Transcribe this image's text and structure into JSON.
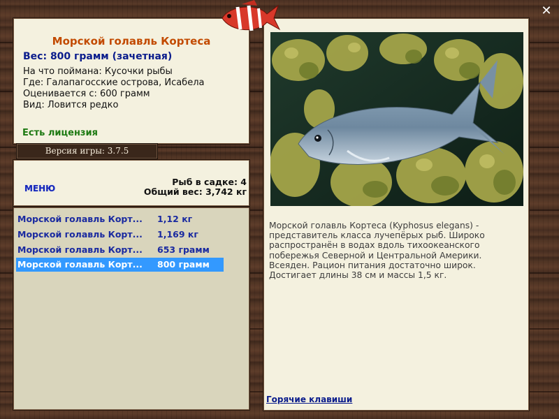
{
  "window": {
    "close_icon": "close-icon"
  },
  "fish_info": {
    "title": "Морской голавль Кортеса",
    "weight": "Вес: 800 грамм (зачетная)",
    "caught_with": "На что поймана: Кусочки рыбы",
    "location": "Где: Галапагосские острова, Исабела",
    "valued_from": "Оценивается с: 600 грамм",
    "rarity": "Вид: Ловится редко",
    "license": "Есть лицензия"
  },
  "version": "Версия игры: 3.7.5",
  "menu_label": "МЕНЮ",
  "stats": {
    "fish_in_keepnet": "Рыб в садке: 4",
    "total_weight": "Общий вес: 3,742 кг"
  },
  "catch_list": [
    {
      "name": "Морской голавль Корт...",
      "weight": "1,12 кг"
    },
    {
      "name": "Морской голавль Корт...",
      "weight": "1,169 кг"
    },
    {
      "name": "Морской голавль Корт...",
      "weight": "653 грамм"
    },
    {
      "name": "Морской голавль Корт...",
      "weight": "800 грамм",
      "selected": true
    }
  ],
  "description": "Морской голавль Кортеса (Kyphosus elegans) - представитель класса лучепёрых рыб. Широко распространён в водах вдоль тихоокеанского побережья Северной и Центральной Америки. Всеяден. Рацион питания достаточно широк. Достигает длины 38 см и массы 1,5 кг.",
  "hotkeys_label": "Горячие клавиши",
  "colors": {
    "title": "#c24a00",
    "weight": "#0b1d8c",
    "license": "#1e7a13",
    "selection": "#3399ff"
  }
}
